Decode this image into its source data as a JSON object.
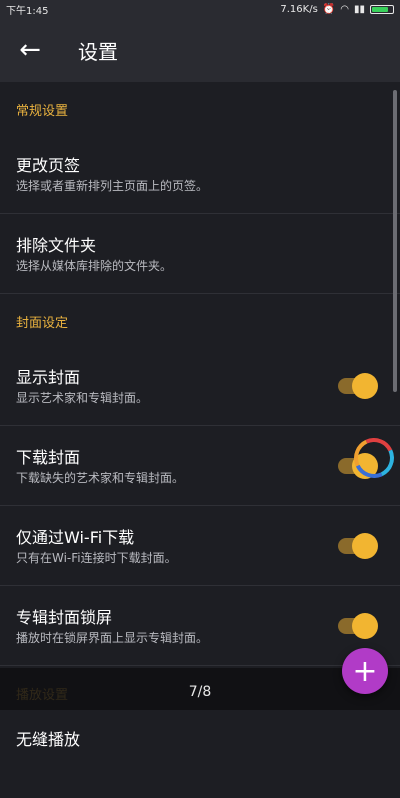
{
  "status_bar": {
    "time": "下午1:45",
    "network_speed": "7.16K/s"
  },
  "toolbar": {
    "title": "设置"
  },
  "sections": {
    "general": "常规设置",
    "cover": "封面设定",
    "playback": "播放设置"
  },
  "items": {
    "change_tabs": {
      "label": "更改页签",
      "desc": "选择或者重新排列主页面上的页签。"
    },
    "exclude_folders": {
      "label": "排除文件夹",
      "desc": "选择从媒体库排除的文件夹。"
    },
    "show_cover": {
      "label": "显示封面",
      "desc": "显示艺术家和专辑封面。",
      "checked": true
    },
    "download_cover": {
      "label": "下载封面",
      "desc": "下载缺失的艺术家和专辑封面。",
      "checked": true
    },
    "wifi_only": {
      "label": "仅通过Wi-Fi下载",
      "desc": "只有在Wi-Fi连接时下载封面。",
      "checked": true
    },
    "lockscreen_cover": {
      "label": "专辑封面锁屏",
      "desc": "播放时在锁屏界面上显示专辑封面。",
      "checked": true
    },
    "gapless": {
      "label": "无缝播放"
    }
  },
  "page_indicator": "7/8",
  "colors": {
    "accent": "#f2b531",
    "section_header": "#e9b23f",
    "fab": "#b13bc7"
  }
}
